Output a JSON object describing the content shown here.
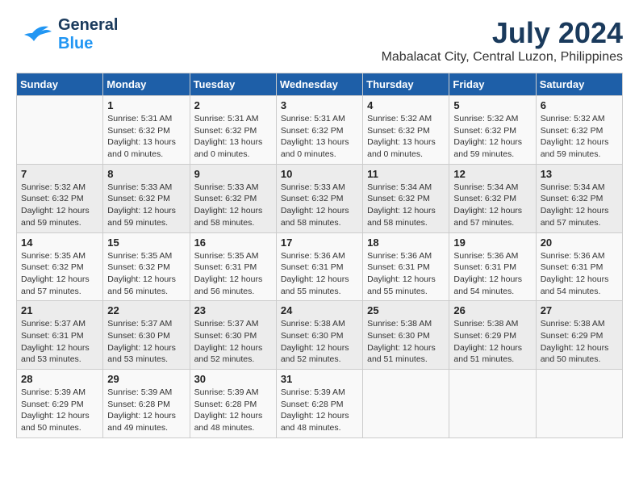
{
  "header": {
    "logo_line1": "General",
    "logo_line2": "Blue",
    "title": "July 2024",
    "subtitle": "Mabalacat City, Central Luzon, Philippines"
  },
  "calendar": {
    "weekdays": [
      "Sunday",
      "Monday",
      "Tuesday",
      "Wednesday",
      "Thursday",
      "Friday",
      "Saturday"
    ],
    "weeks": [
      [
        {
          "day": "",
          "sunrise": "",
          "sunset": "",
          "daylight": ""
        },
        {
          "day": "1",
          "sunrise": "Sunrise: 5:31 AM",
          "sunset": "Sunset: 6:32 PM",
          "daylight": "Daylight: 13 hours and 0 minutes."
        },
        {
          "day": "2",
          "sunrise": "Sunrise: 5:31 AM",
          "sunset": "Sunset: 6:32 PM",
          "daylight": "Daylight: 13 hours and 0 minutes."
        },
        {
          "day": "3",
          "sunrise": "Sunrise: 5:31 AM",
          "sunset": "Sunset: 6:32 PM",
          "daylight": "Daylight: 13 hours and 0 minutes."
        },
        {
          "day": "4",
          "sunrise": "Sunrise: 5:32 AM",
          "sunset": "Sunset: 6:32 PM",
          "daylight": "Daylight: 13 hours and 0 minutes."
        },
        {
          "day": "5",
          "sunrise": "Sunrise: 5:32 AM",
          "sunset": "Sunset: 6:32 PM",
          "daylight": "Daylight: 12 hours and 59 minutes."
        },
        {
          "day": "6",
          "sunrise": "Sunrise: 5:32 AM",
          "sunset": "Sunset: 6:32 PM",
          "daylight": "Daylight: 12 hours and 59 minutes."
        }
      ],
      [
        {
          "day": "7",
          "sunrise": "Sunrise: 5:32 AM",
          "sunset": "Sunset: 6:32 PM",
          "daylight": "Daylight: 12 hours and 59 minutes."
        },
        {
          "day": "8",
          "sunrise": "Sunrise: 5:33 AM",
          "sunset": "Sunset: 6:32 PM",
          "daylight": "Daylight: 12 hours and 59 minutes."
        },
        {
          "day": "9",
          "sunrise": "Sunrise: 5:33 AM",
          "sunset": "Sunset: 6:32 PM",
          "daylight": "Daylight: 12 hours and 58 minutes."
        },
        {
          "day": "10",
          "sunrise": "Sunrise: 5:33 AM",
          "sunset": "Sunset: 6:32 PM",
          "daylight": "Daylight: 12 hours and 58 minutes."
        },
        {
          "day": "11",
          "sunrise": "Sunrise: 5:34 AM",
          "sunset": "Sunset: 6:32 PM",
          "daylight": "Daylight: 12 hours and 58 minutes."
        },
        {
          "day": "12",
          "sunrise": "Sunrise: 5:34 AM",
          "sunset": "Sunset: 6:32 PM",
          "daylight": "Daylight: 12 hours and 57 minutes."
        },
        {
          "day": "13",
          "sunrise": "Sunrise: 5:34 AM",
          "sunset": "Sunset: 6:32 PM",
          "daylight": "Daylight: 12 hours and 57 minutes."
        }
      ],
      [
        {
          "day": "14",
          "sunrise": "Sunrise: 5:35 AM",
          "sunset": "Sunset: 6:32 PM",
          "daylight": "Daylight: 12 hours and 57 minutes."
        },
        {
          "day": "15",
          "sunrise": "Sunrise: 5:35 AM",
          "sunset": "Sunset: 6:32 PM",
          "daylight": "Daylight: 12 hours and 56 minutes."
        },
        {
          "day": "16",
          "sunrise": "Sunrise: 5:35 AM",
          "sunset": "Sunset: 6:31 PM",
          "daylight": "Daylight: 12 hours and 56 minutes."
        },
        {
          "day": "17",
          "sunrise": "Sunrise: 5:36 AM",
          "sunset": "Sunset: 6:31 PM",
          "daylight": "Daylight: 12 hours and 55 minutes."
        },
        {
          "day": "18",
          "sunrise": "Sunrise: 5:36 AM",
          "sunset": "Sunset: 6:31 PM",
          "daylight": "Daylight: 12 hours and 55 minutes."
        },
        {
          "day": "19",
          "sunrise": "Sunrise: 5:36 AM",
          "sunset": "Sunset: 6:31 PM",
          "daylight": "Daylight: 12 hours and 54 minutes."
        },
        {
          "day": "20",
          "sunrise": "Sunrise: 5:36 AM",
          "sunset": "Sunset: 6:31 PM",
          "daylight": "Daylight: 12 hours and 54 minutes."
        }
      ],
      [
        {
          "day": "21",
          "sunrise": "Sunrise: 5:37 AM",
          "sunset": "Sunset: 6:31 PM",
          "daylight": "Daylight: 12 hours and 53 minutes."
        },
        {
          "day": "22",
          "sunrise": "Sunrise: 5:37 AM",
          "sunset": "Sunset: 6:30 PM",
          "daylight": "Daylight: 12 hours and 53 minutes."
        },
        {
          "day": "23",
          "sunrise": "Sunrise: 5:37 AM",
          "sunset": "Sunset: 6:30 PM",
          "daylight": "Daylight: 12 hours and 52 minutes."
        },
        {
          "day": "24",
          "sunrise": "Sunrise: 5:38 AM",
          "sunset": "Sunset: 6:30 PM",
          "daylight": "Daylight: 12 hours and 52 minutes."
        },
        {
          "day": "25",
          "sunrise": "Sunrise: 5:38 AM",
          "sunset": "Sunset: 6:30 PM",
          "daylight": "Daylight: 12 hours and 51 minutes."
        },
        {
          "day": "26",
          "sunrise": "Sunrise: 5:38 AM",
          "sunset": "Sunset: 6:29 PM",
          "daylight": "Daylight: 12 hours and 51 minutes."
        },
        {
          "day": "27",
          "sunrise": "Sunrise: 5:38 AM",
          "sunset": "Sunset: 6:29 PM",
          "daylight": "Daylight: 12 hours and 50 minutes."
        }
      ],
      [
        {
          "day": "28",
          "sunrise": "Sunrise: 5:39 AM",
          "sunset": "Sunset: 6:29 PM",
          "daylight": "Daylight: 12 hours and 50 minutes."
        },
        {
          "day": "29",
          "sunrise": "Sunrise: 5:39 AM",
          "sunset": "Sunset: 6:28 PM",
          "daylight": "Daylight: 12 hours and 49 minutes."
        },
        {
          "day": "30",
          "sunrise": "Sunrise: 5:39 AM",
          "sunset": "Sunset: 6:28 PM",
          "daylight": "Daylight: 12 hours and 48 minutes."
        },
        {
          "day": "31",
          "sunrise": "Sunrise: 5:39 AM",
          "sunset": "Sunset: 6:28 PM",
          "daylight": "Daylight: 12 hours and 48 minutes."
        },
        {
          "day": "",
          "sunrise": "",
          "sunset": "",
          "daylight": ""
        },
        {
          "day": "",
          "sunrise": "",
          "sunset": "",
          "daylight": ""
        },
        {
          "day": "",
          "sunrise": "",
          "sunset": "",
          "daylight": ""
        }
      ]
    ]
  }
}
